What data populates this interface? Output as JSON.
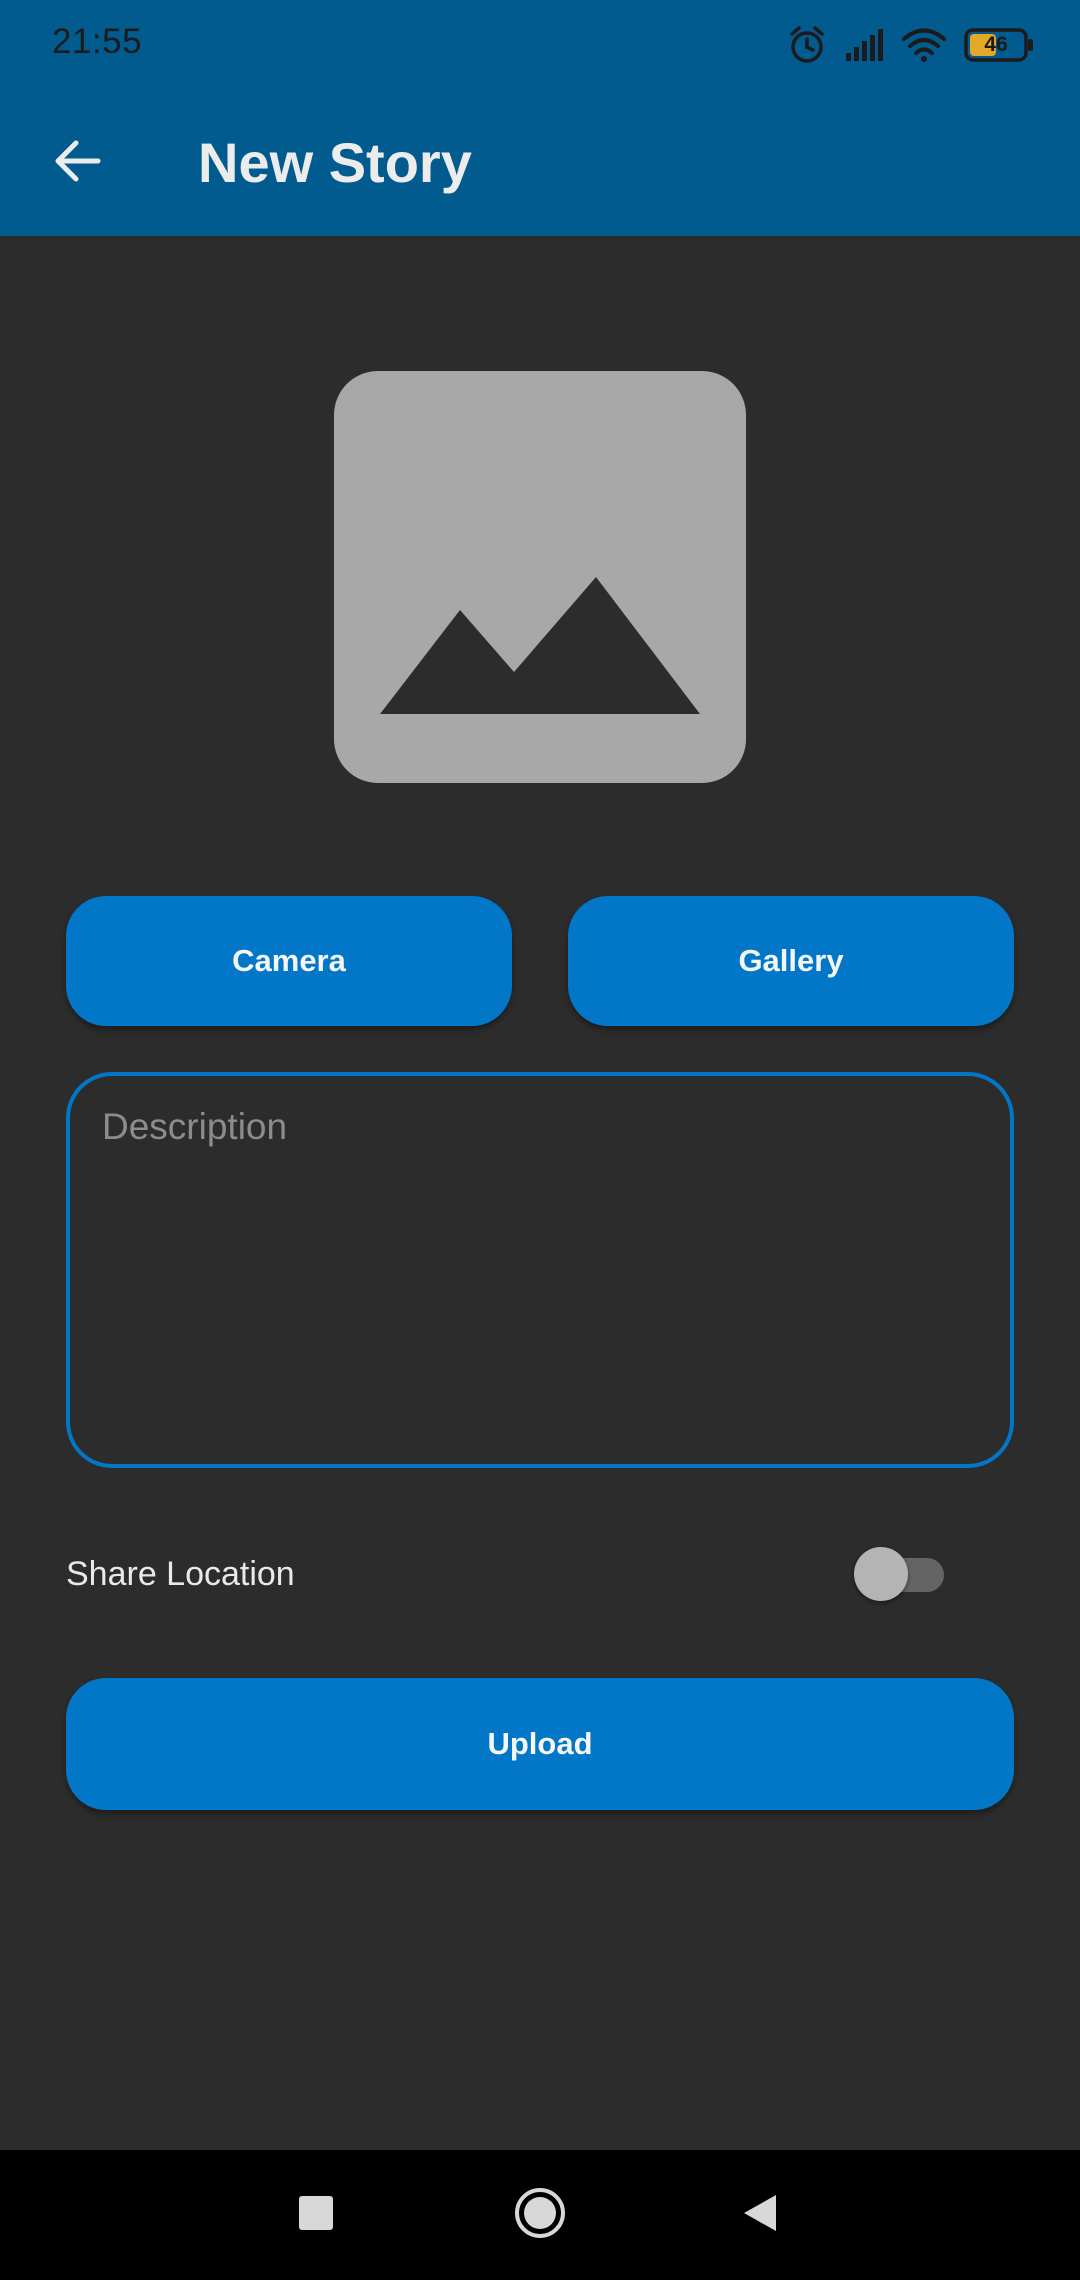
{
  "status_bar": {
    "time": "21:55",
    "battery_level": "46",
    "icons": [
      "alarm-icon",
      "signal-icon",
      "wifi-icon",
      "battery-icon"
    ]
  },
  "app_bar": {
    "title": "New Story",
    "back_icon": "arrow-left-icon"
  },
  "image_preview": {
    "icon": "image-placeholder-icon"
  },
  "buttons": {
    "camera": "Camera",
    "gallery": "Gallery",
    "upload": "Upload"
  },
  "description": {
    "placeholder": "Description",
    "value": ""
  },
  "share_location": {
    "label": "Share Location",
    "enabled": false
  },
  "nav_bar": {
    "icons": [
      "recents-icon",
      "home-icon",
      "back-icon"
    ]
  },
  "colors": {
    "app_bar": "#025b8f",
    "accent": "#0277c8",
    "background": "#2c2c2c",
    "placeholder_image": "#a8a8a8"
  }
}
